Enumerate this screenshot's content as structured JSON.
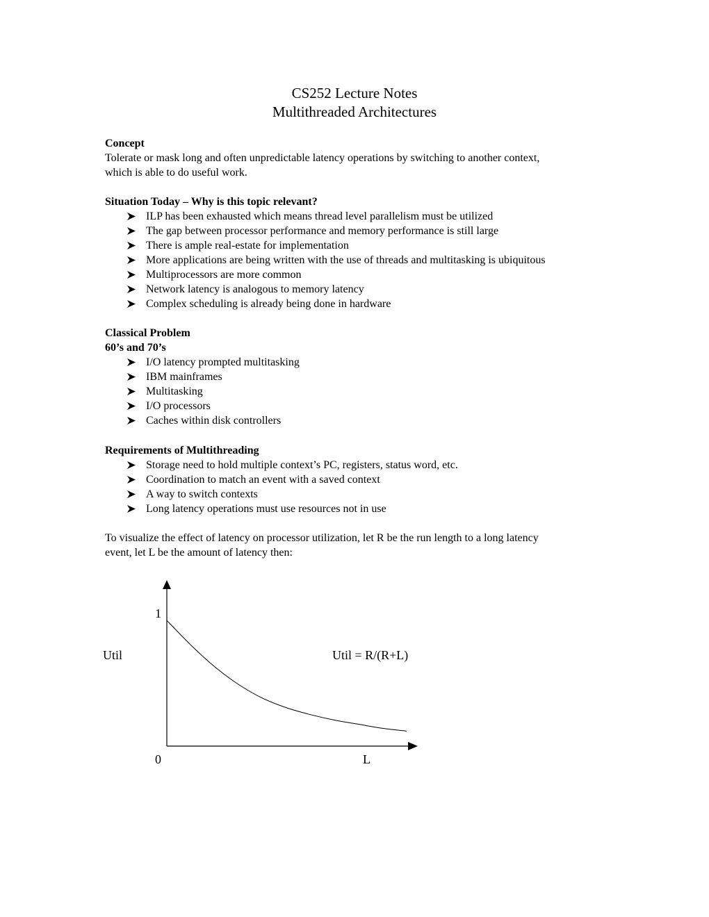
{
  "document": {
    "title_line1": "CS252 Lecture Notes",
    "title_line2": "Multithreaded Architectures"
  },
  "concept": {
    "heading": "Concept",
    "text_line1": "Tolerate or mask long and often unpredictable latency operations by switching to another context,",
    "text_line2": "which is able to do useful work."
  },
  "situation": {
    "heading": "Situation Today – Why is this topic relevant?",
    "items": [
      "ILP has been exhausted which means thread level parallelism must be utilized",
      "The gap between processor performance and memory performance is still large",
      "There is ample real-estate for implementation",
      "More applications are being written with the use of threads and multitasking is ubiquitous",
      "Multiprocessors are more common",
      "Network latency is analogous to memory latency",
      "Complex scheduling is already being done in hardware"
    ]
  },
  "classical": {
    "heading": "Classical Problem",
    "subheading": "60’s and 70’s",
    "items": [
      "I/O latency prompted multitasking",
      "IBM mainframes",
      "Multitasking",
      "I/O processors",
      "Caches within disk controllers"
    ]
  },
  "requirements": {
    "heading": "Requirements of Multithreading",
    "items": [
      "Storage need to hold multiple context’s PC, registers, status word, etc.",
      "Coordination to match an event with a saved context",
      "A way to switch contexts",
      "Long latency operations must use resources not in use"
    ]
  },
  "visualize": {
    "text_line1": "To visualize the effect of latency on processor utilization, let R be the run length to a long latency",
    "text_line2": "event, let L be the amount of latency then:"
  },
  "chart_data": {
    "type": "line",
    "title": "",
    "xlabel": "L",
    "ylabel": "Util",
    "annotation": "Util = R/(R+L)",
    "y_tick_labels": [
      "0",
      "1"
    ],
    "x_tick_labels": [
      "0"
    ],
    "xlim": [
      0,
      10
    ],
    "ylim": [
      0,
      1.2
    ],
    "grid": false,
    "legend": "none",
    "series": [
      {
        "name": "Util = R/(R+L)",
        "x": [
          0,
          1,
          2,
          3,
          4,
          5,
          6,
          7,
          8,
          9,
          10
        ],
        "y": [
          0.92,
          0.74,
          0.58,
          0.45,
          0.35,
          0.28,
          0.23,
          0.19,
          0.16,
          0.13,
          0.11
        ]
      }
    ]
  }
}
